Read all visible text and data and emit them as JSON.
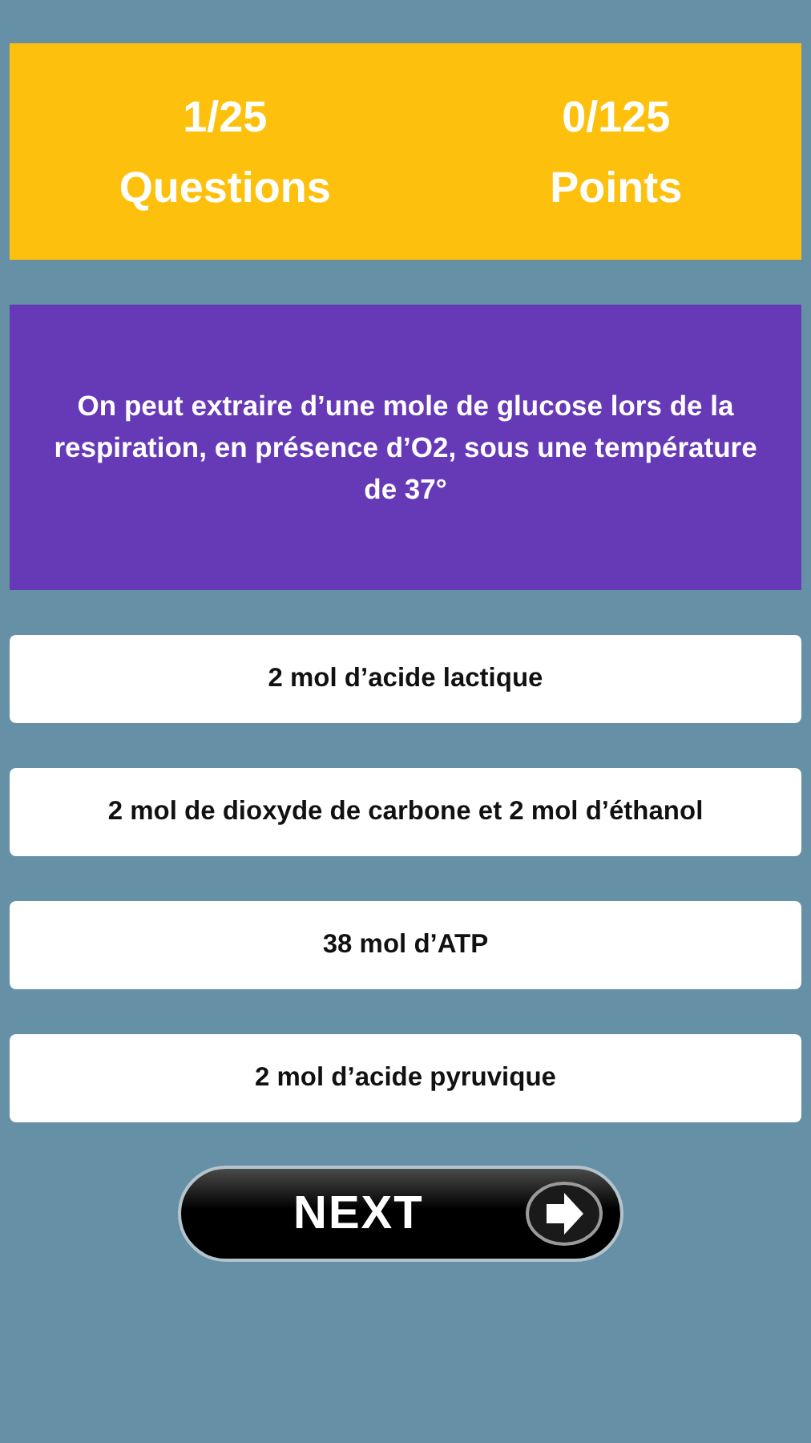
{
  "score_panel": {
    "questions": {
      "value": "1/25",
      "label": "Questions"
    },
    "points": {
      "value": "0/125",
      "label": "Points"
    }
  },
  "question": "On peut extraire d’une mole de glucose lors de la respiration, en présence d’O2, sous une température de 37°",
  "answers": [
    "2 mol d’acide lactique",
    "2 mol de dioxyde de carbone et 2 mol d’éthanol",
    "38 mol d’ATP",
    "2 mol d’acide pyruvique"
  ],
  "next_button": {
    "label": "NEXT"
  }
}
